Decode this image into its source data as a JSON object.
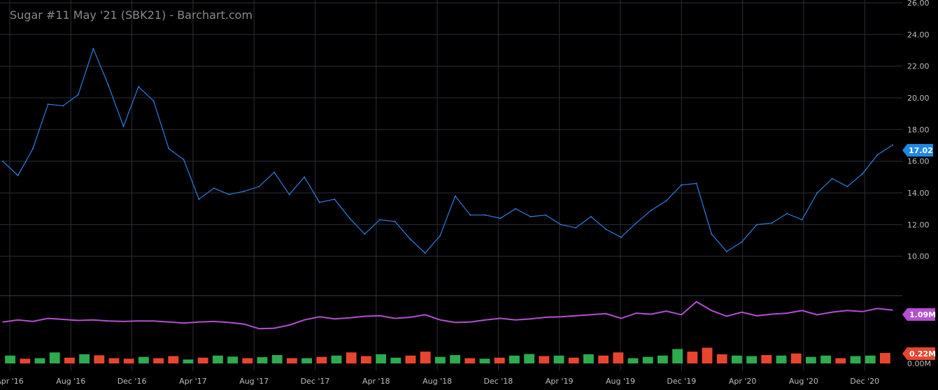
{
  "title": "Sugar #11 May '21 (SBK21) - Barchart.com",
  "colors": {
    "background": "#000000",
    "grid": "#2a2f36",
    "price_line": "#2f7fe0",
    "price_tag": "#1e88e5",
    "oi_line": "#b44fd1",
    "oi_tag": "#b44fd1",
    "vol_up": "#2eaa4f",
    "vol_down": "#e8452f",
    "vol_tag": "#e8452f"
  },
  "chart_data": [
    {
      "type": "line",
      "name": "price",
      "ylim": [
        8.0,
        26.0
      ],
      "yticks": [
        "26.00",
        "24.00",
        "22.00",
        "20.00",
        "18.00",
        "16.00",
        "14.00",
        "12.00",
        "10.00"
      ],
      "xticks": [
        "Apr '16",
        "Aug '16",
        "Dec '16",
        "Apr '17",
        "Aug '17",
        "Dec '17",
        "Apr '18",
        "Aug '18",
        "Dec '18",
        "Apr '19",
        "Aug '19",
        "Dec '19",
        "Apr '20",
        "Aug '20",
        "Dec '20"
      ],
      "last_value": "17.02",
      "x": [
        "Apr '16",
        "May '16",
        "Jun '16",
        "Jul '16",
        "Aug '16",
        "Sep '16",
        "Oct '16",
        "Nov '16",
        "Dec '16",
        "Jan '17",
        "Feb '17",
        "Mar '17",
        "Apr '17",
        "May '17",
        "Jun '17",
        "Jul '17",
        "Aug '17",
        "Sep '17",
        "Oct '17",
        "Nov '17",
        "Dec '17",
        "Jan '18",
        "Feb '18",
        "Mar '18",
        "Apr '18",
        "May '18",
        "Jun '18",
        "Jul '18",
        "Aug '18",
        "Sep '18",
        "Oct '18",
        "Nov '18",
        "Dec '18",
        "Jan '19",
        "Feb '19",
        "Mar '19",
        "Apr '19",
        "May '19",
        "Jun '19",
        "Jul '19",
        "Aug '19",
        "Sep '19",
        "Oct '19",
        "Nov '19",
        "Dec '19",
        "Jan '20",
        "Feb '20",
        "Mar '20",
        "Apr '20",
        "May '20",
        "Jun '20",
        "Jul '20",
        "Aug '20",
        "Sep '20",
        "Oct '20",
        "Nov '20",
        "Dec '20",
        "Jan '21",
        "Feb '21",
        "Mar '21"
      ],
      "values": [
        16.0,
        15.1,
        16.8,
        19.6,
        19.5,
        20.2,
        23.1,
        20.8,
        18.2,
        20.7,
        19.8,
        16.8,
        16.1,
        13.6,
        14.3,
        13.9,
        14.1,
        14.4,
        15.3,
        13.9,
        15.0,
        13.4,
        13.6,
        12.4,
        11.4,
        12.3,
        12.2,
        11.1,
        10.2,
        11.3,
        13.8,
        12.6,
        12.6,
        12.4,
        13.0,
        12.5,
        12.6,
        12.0,
        11.8,
        12.5,
        11.7,
        11.2,
        12.1,
        12.9,
        13.5,
        14.5,
        14.6,
        11.4,
        10.3,
        10.9,
        12.0,
        12.1,
        12.7,
        12.3,
        14.0,
        14.9,
        14.4,
        15.2,
        16.4,
        17.02
      ]
    },
    {
      "type": "line",
      "name": "open interest",
      "last_value": "1.09M",
      "values": [
        0.86,
        0.9,
        0.87,
        0.93,
        0.91,
        0.89,
        0.9,
        0.88,
        0.87,
        0.88,
        0.88,
        0.86,
        0.84,
        0.86,
        0.87,
        0.85,
        0.82,
        0.73,
        0.74,
        0.8,
        0.9,
        0.96,
        0.92,
        0.94,
        0.97,
        0.98,
        0.93,
        0.95,
        1.0,
        0.9,
        0.85,
        0.86,
        0.9,
        0.93,
        0.9,
        0.92,
        0.95,
        0.96,
        0.98,
        1.0,
        1.02,
        0.93,
        1.03,
        1.01,
        1.07,
        1.0,
        1.25,
        1.08,
        0.97,
        1.05,
        0.98,
        1.01,
        1.03,
        1.08,
        1.0,
        1.05,
        1.08,
        1.06,
        1.12,
        1.09
      ]
    },
    {
      "type": "bar",
      "name": "volume",
      "last_value": "0.22M",
      "ytick": "0.00M",
      "values": [
        0.3,
        0.18,
        0.2,
        0.42,
        0.22,
        0.35,
        0.31,
        0.2,
        0.18,
        0.25,
        0.2,
        0.28,
        0.15,
        0.22,
        0.3,
        0.26,
        0.2,
        0.24,
        0.32,
        0.2,
        0.2,
        0.25,
        0.3,
        0.42,
        0.28,
        0.35,
        0.22,
        0.3,
        0.45,
        0.25,
        0.32,
        0.2,
        0.18,
        0.22,
        0.3,
        0.36,
        0.28,
        0.3,
        0.22,
        0.35,
        0.3,
        0.42,
        0.2,
        0.25,
        0.3,
        0.55,
        0.45,
        0.6,
        0.35,
        0.3,
        0.28,
        0.32,
        0.3,
        0.38,
        0.25,
        0.3,
        0.2,
        0.28,
        0.3,
        0.4
      ],
      "up": [
        1,
        0,
        1,
        1,
        0,
        1,
        0,
        0,
        0,
        1,
        0,
        0,
        1,
        0,
        1,
        1,
        0,
        1,
        1,
        0,
        1,
        0,
        1,
        0,
        0,
        1,
        1,
        0,
        0,
        1,
        1,
        0,
        1,
        0,
        1,
        1,
        0,
        1,
        0,
        1,
        0,
        0,
        1,
        1,
        1,
        1,
        0,
        0,
        0,
        1,
        1,
        0,
        1,
        0,
        1,
        1,
        0,
        1,
        1,
        0
      ]
    }
  ]
}
